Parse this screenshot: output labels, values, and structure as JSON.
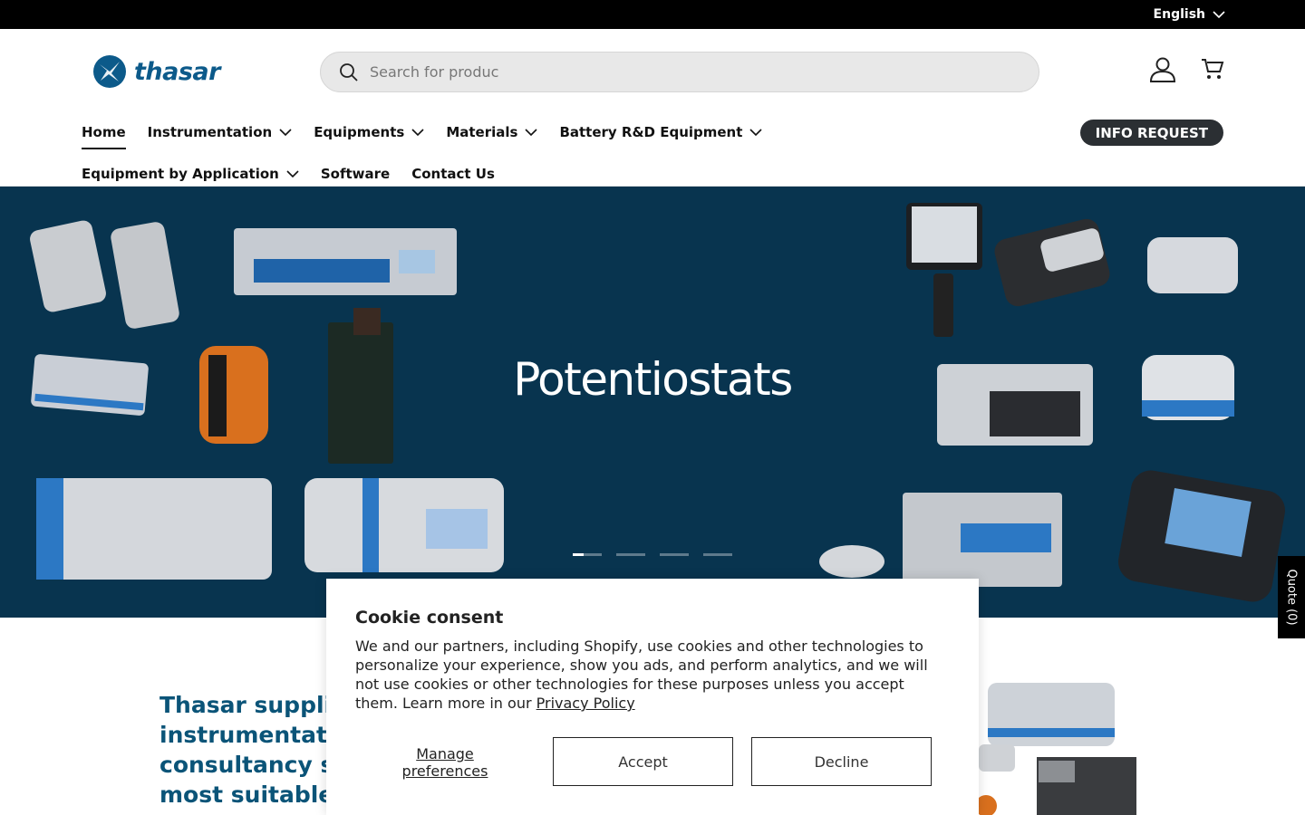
{
  "topbar": {
    "language": "English"
  },
  "header": {
    "logo_text": "thasar",
    "search_placeholder": "Search for produc",
    "icons": [
      "account-icon",
      "cart-icon"
    ]
  },
  "nav": {
    "items": [
      {
        "label": "Home",
        "has_dropdown": false,
        "active": true
      },
      {
        "label": "Instrumentation",
        "has_dropdown": true
      },
      {
        "label": "Equipments",
        "has_dropdown": true
      },
      {
        "label": "Materials",
        "has_dropdown": true
      },
      {
        "label": "Battery R&D Equipment",
        "has_dropdown": true
      },
      {
        "label": "Equipment by Application",
        "has_dropdown": true
      },
      {
        "label": "Software",
        "has_dropdown": false
      },
      {
        "label": "Contact Us",
        "has_dropdown": false
      }
    ],
    "info_request": "INFO REQUEST"
  },
  "hero": {
    "title": "Potentiostats",
    "slide_count": 4,
    "active_slide": 0
  },
  "quote_tab": "Quote (0)",
  "intro": {
    "line1": "Thasar supplie",
    "line2": "instrumentatio",
    "line3": "consultancy se",
    "line4": "most suitable c"
  },
  "cookie": {
    "title": "Cookie consent",
    "body": "We and our partners, including Shopify, use cookies and other technologies to personalize your experience, show you ads, and perform analytics, and we will not use cookies or other technologies for these purposes unless you accept them. Learn more in our ",
    "link": "Privacy Policy",
    "manage": "Manage preferences",
    "accept": "Accept",
    "decline": "Decline"
  },
  "colors": {
    "hero_bg": "#08344f",
    "brand": "#0b5478",
    "info_btn": "#2b2f33"
  }
}
